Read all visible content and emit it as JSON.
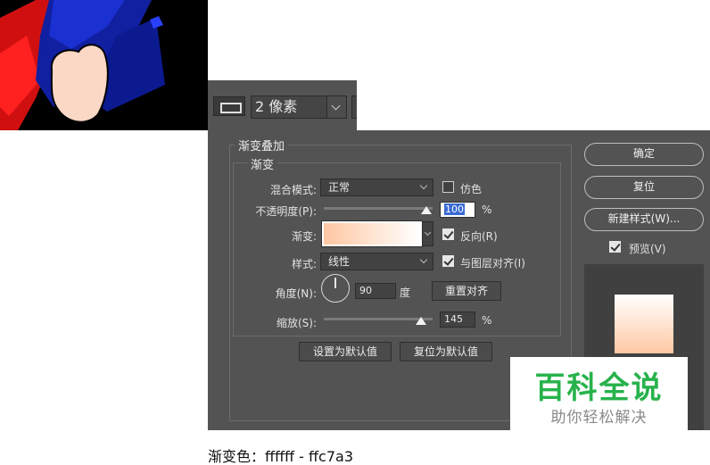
{
  "toolbar": {
    "stroke_size": "2 像素"
  },
  "dialog": {
    "section_title": "渐变叠加",
    "group_title": "渐变",
    "blend_mode": {
      "label": "混合模式:",
      "value": "正常"
    },
    "dither": {
      "label": "仿色",
      "checked": false
    },
    "opacity": {
      "label": "不透明度(P):",
      "value": "100",
      "unit": "%",
      "level_percent": 100
    },
    "gradient": {
      "label": "渐变:",
      "start_color": "#ffc7a3",
      "end_color": "#ffffff"
    },
    "reverse": {
      "label": "反向(R)",
      "checked": true
    },
    "style": {
      "label": "样式:",
      "value": "线性"
    },
    "align_layer": {
      "label": "与图层对齐(I)",
      "checked": true
    },
    "angle": {
      "label": "角度(N):",
      "value": "90",
      "unit": "度",
      "reset_button": "重置对齐"
    },
    "scale": {
      "label": "缩放(S):",
      "value": "145",
      "unit": "%"
    },
    "set_default_button": "设置为默认值",
    "reset_default_button": "复位为默认值"
  },
  "side_buttons": {
    "ok": "确定",
    "reset": "复位",
    "new_style": "新建样式(W)...",
    "preview": {
      "label": "预览(V)",
      "checked": true
    }
  },
  "watermark": {
    "title": "百科全说",
    "subtitle": "助你轻松解决"
  },
  "caption": "渐变色：ffffff - ffc7a3"
}
